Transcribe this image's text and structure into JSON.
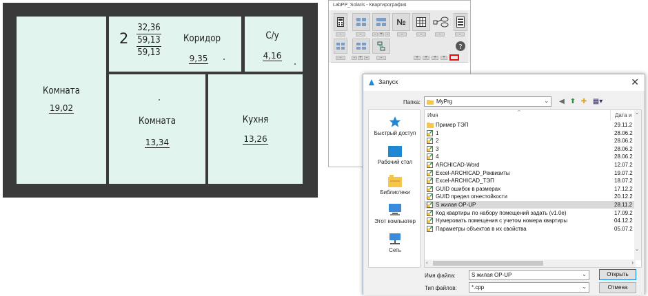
{
  "floor_plan": {
    "rooms": {
      "room1": {
        "name": "Комната",
        "area": "19,02"
      },
      "corridor": {
        "name": "Коридор",
        "area": "9,35"
      },
      "wc": {
        "name": "С/у",
        "area": "4,16"
      },
      "room2": {
        "name": "Комната",
        "area": "13,34"
      },
      "kitchen": {
        "name": "Кухня",
        "area": "13,26"
      }
    },
    "apartment": {
      "number": "2",
      "values": [
        "32,36",
        "59,13",
        "59,13"
      ]
    }
  },
  "labpp_window": {
    "title": "LabPP_Solaris - Квартирография",
    "numbering_label": "№"
  },
  "dialog": {
    "title": "Запуск",
    "folder_label": "Папка:",
    "folder_value": "MyPrg",
    "places": [
      {
        "label": "Быстрый доступ",
        "icon": "star-icon"
      },
      {
        "label": "Рабочий стол",
        "icon": "desktop-icon"
      },
      {
        "label": "Библиотеки",
        "icon": "libraries-icon"
      },
      {
        "label": "Этот компьютер",
        "icon": "computer-icon"
      },
      {
        "label": "Сеть",
        "icon": "network-icon"
      }
    ],
    "columns": {
      "name": "Имя",
      "date": "Дата и"
    },
    "files": [
      {
        "name": "Пример ТЭП",
        "date": "29.11.2",
        "type": "folder"
      },
      {
        "name": "1",
        "date": "28.06.2",
        "type": "file"
      },
      {
        "name": "2",
        "date": "28.06.2",
        "type": "file"
      },
      {
        "name": "3",
        "date": "28.06.2",
        "type": "file"
      },
      {
        "name": "4",
        "date": "28.06.2",
        "type": "file"
      },
      {
        "name": "ARCHICAD-Word",
        "date": "12.07.2",
        "type": "file"
      },
      {
        "name": "Excel-ARCHICAD_Реквизиты",
        "date": "19.07.2",
        "type": "file"
      },
      {
        "name": "Excel-ARCHICAD_ТЭП",
        "date": "18.07.2",
        "type": "file"
      },
      {
        "name": "GUID ошибок в размерах",
        "date": "17.12.2",
        "type": "file"
      },
      {
        "name": "GUID предел огнестойкости",
        "date": "20.12.2",
        "type": "file"
      },
      {
        "name": "S жилая OP-UP",
        "date": "28.11.2",
        "type": "file",
        "selected": true
      },
      {
        "name": "Код квартиры по набору помещений задать (v1.0e)",
        "date": "17.09.2",
        "type": "file"
      },
      {
        "name": "Нумеровать помещения с учетом номера квартиры",
        "date": "04.12.2",
        "type": "file"
      },
      {
        "name": "Параметры объектов в их свойства",
        "date": "05.07.2",
        "type": "file"
      }
    ],
    "filename_label": "Имя файла:",
    "filename_value": "S жилая OP-UP",
    "filetype_label": "Тип файлов:",
    "filetype_value": "*.cpp",
    "open_button": "Открыть",
    "cancel_button": "Отмена"
  },
  "colors": {
    "room_fill": "#e1f4ee",
    "wall": "#3a3a3a",
    "highlight": "#e01010",
    "folder": "#f6c64a",
    "accent": "#0078d7"
  }
}
